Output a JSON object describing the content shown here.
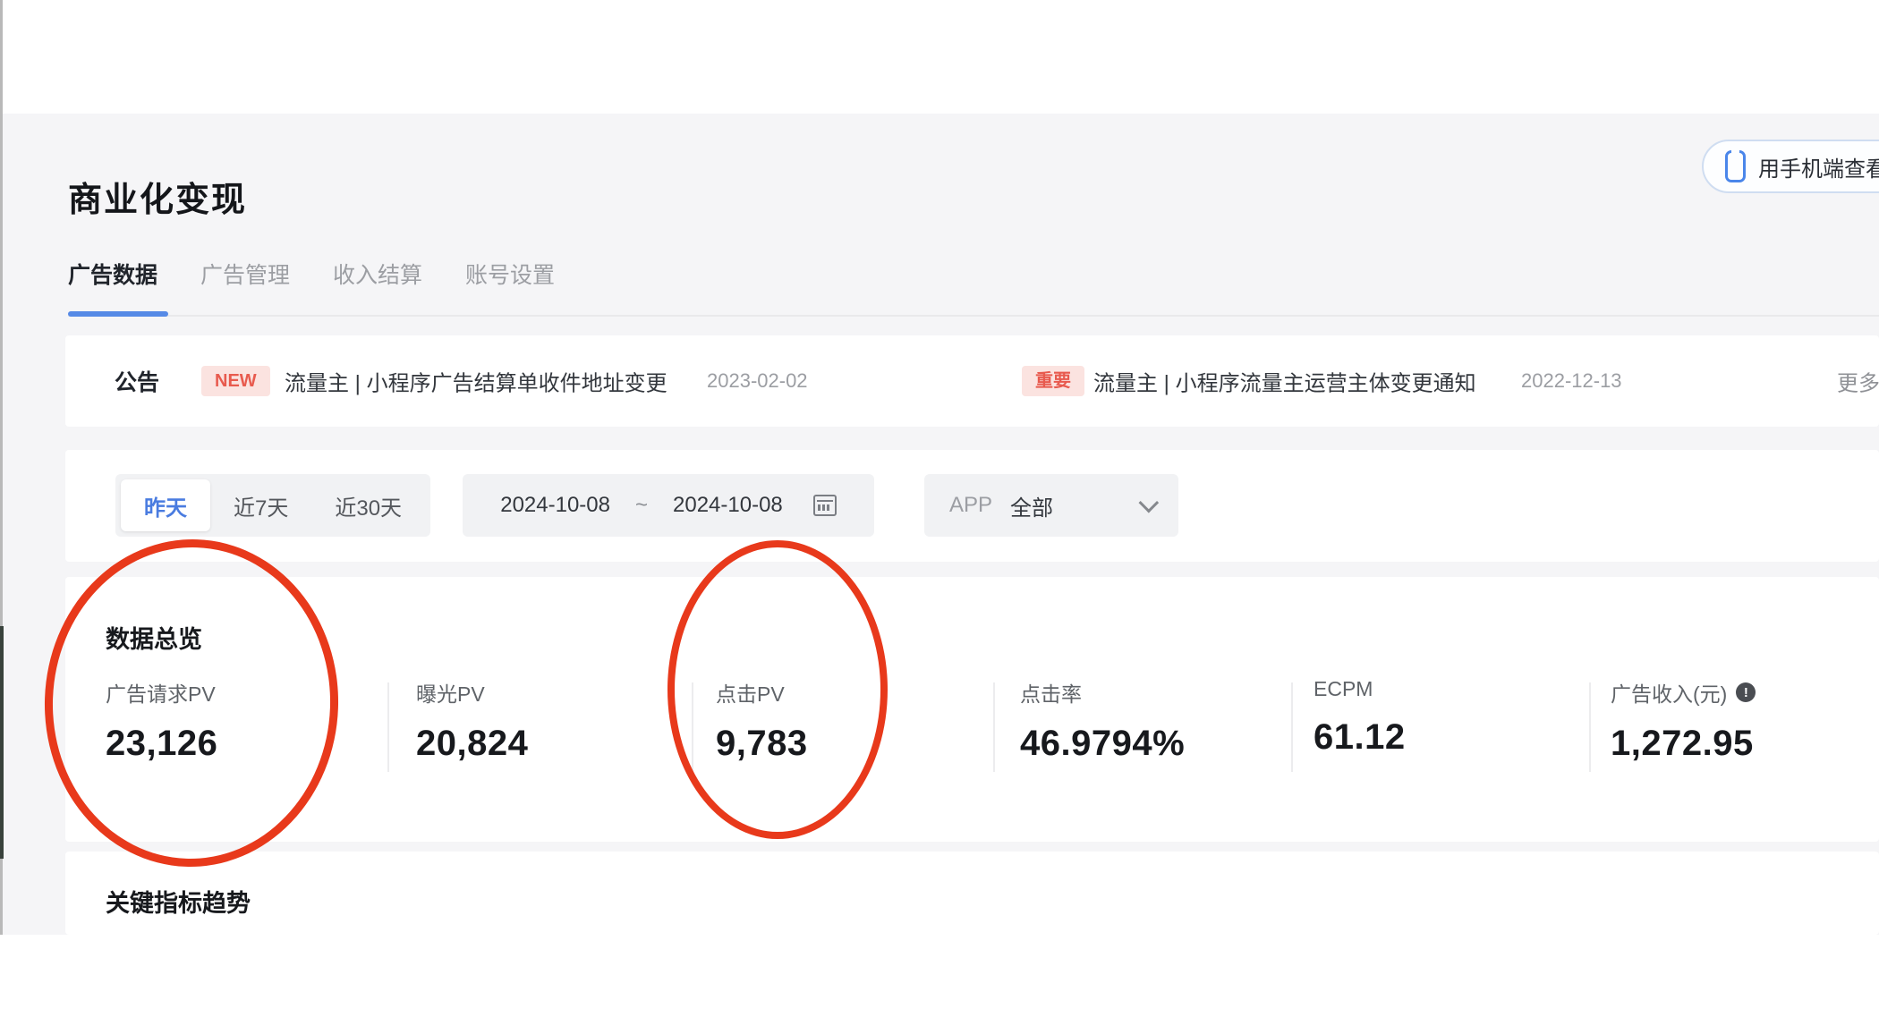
{
  "page": {
    "title": "商业化变现",
    "mobile_button_label": "用手机端查看数据"
  },
  "tabs": [
    {
      "label": "广告数据",
      "active": true
    },
    {
      "label": "广告管理",
      "active": false
    },
    {
      "label": "收入结算",
      "active": false
    },
    {
      "label": "账号设置",
      "active": false
    }
  ],
  "announcement": {
    "label": "公告",
    "items": [
      {
        "badge": "NEW",
        "title": "流量主 | 小程序广告结算单收件地址变更",
        "date": "2023-02-02"
      },
      {
        "badge": "重要",
        "title": "流量主 | 小程序流量主运营主体变更通知",
        "date": "2022-12-13"
      }
    ],
    "more_label": "更多"
  },
  "filters": {
    "quick_ranges": [
      {
        "label": "昨天",
        "selected": true
      },
      {
        "label": "近7天",
        "selected": false
      },
      {
        "label": "近30天",
        "selected": false
      }
    ],
    "date_start": "2024-10-08",
    "date_separator": "~",
    "date_end": "2024-10-08",
    "app_label": "APP",
    "app_value": "全部"
  },
  "overview": {
    "title": "数据总览",
    "metrics": [
      {
        "label": "广告请求PV",
        "value": "23,126",
        "circled": true
      },
      {
        "label": "曝光PV",
        "value": "20,824",
        "circled": false
      },
      {
        "label": "点击PV",
        "value": "9,783",
        "circled": true
      },
      {
        "label": "点击率",
        "value": "46.9794%",
        "circled": false
      },
      {
        "label": "ECPM",
        "value": "61.12",
        "circled": false
      },
      {
        "label": "广告收入(元)",
        "value": "1,272.95",
        "circled": false,
        "info_icon": "!"
      }
    ]
  },
  "trend": {
    "title": "关键指标趋势"
  },
  "colors": {
    "page_background": "#f5f5f7",
    "card_background": "#ffffff",
    "accent_blue": "#4a7ce0",
    "badge_background": "#fbe3e0",
    "badge_text": "#e85a4e",
    "annotation_red": "#e8391b",
    "muted_text": "#9c9ea3",
    "dark_text": "#17191d"
  }
}
